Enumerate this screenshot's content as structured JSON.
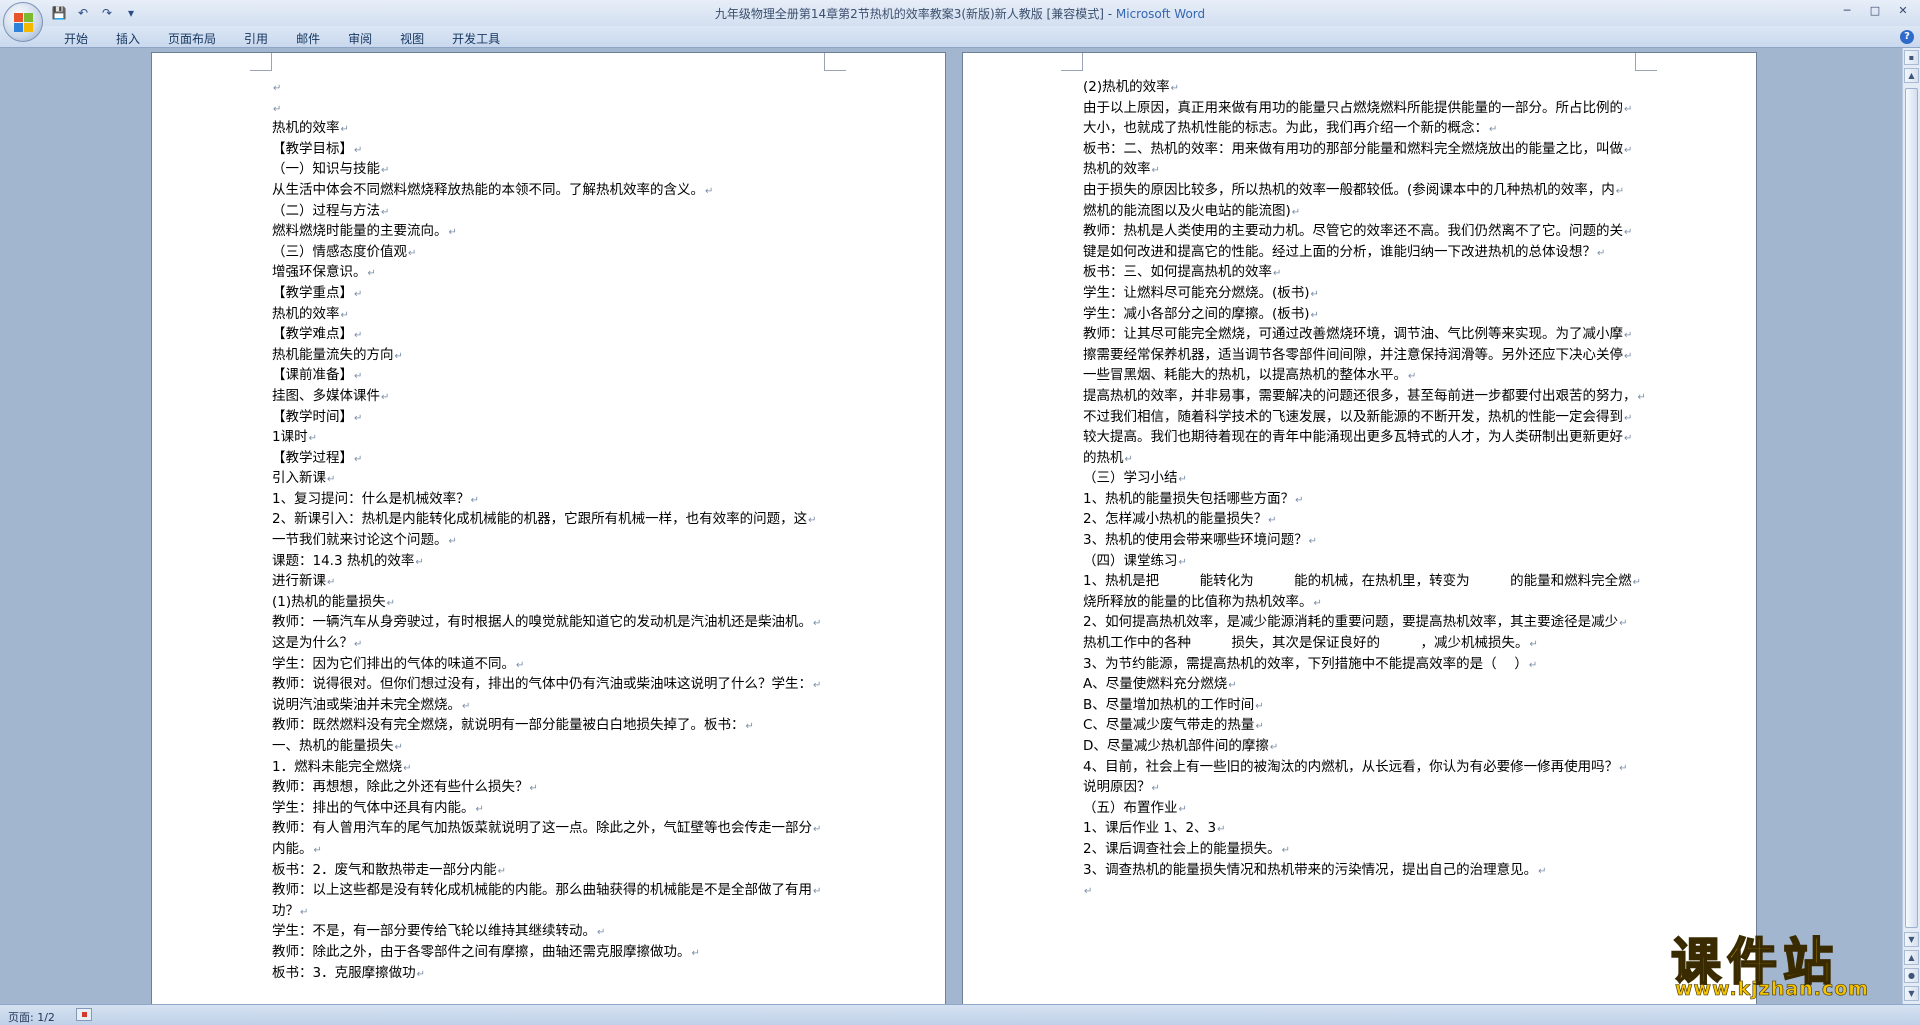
{
  "window": {
    "title": "九年级物理全册第14章第2节热机的效率教案3(新版)新人教版 [兼容模式] - ",
    "app_name": "Microsoft Word",
    "controls": {
      "minimize": "─",
      "maximize": "□",
      "close": "✕"
    }
  },
  "quick_access": {
    "save": "💾",
    "undo": "↶",
    "redo": "↷",
    "customize": "▾"
  },
  "ribbon": {
    "tabs": [
      "开始",
      "插入",
      "页面布局",
      "引用",
      "邮件",
      "审阅",
      "视图",
      "开发工具"
    ],
    "help": "?"
  },
  "pilcrow": "↵",
  "page1_lines": [
    "",
    "",
    "热机的效率",
    "【教学目标】",
    "（一）知识与技能",
    "从生活中体会不同燃料燃烧释放热能的本领不同。了解热机效率的含义。",
    "（二）过程与方法",
    "燃料燃烧时能量的主要流向。",
    "（三）情感态度价值观",
    "增强环保意识。",
    "【教学重点】",
    "热机的效率",
    "【教学难点】",
    "热机能量流失的方向",
    "【课前准备】",
    "挂图、多媒体课件",
    "【教学时间】",
    "1课时",
    "【教学过程】",
    "引入新课",
    "1、复习提问：什么是机械效率？",
    "2、新课引入：热机是内能转化成机械能的机器，它跟所有机械一样，也有效率的问题，这",
    "一节我们就来讨论这个问题。",
    "课题：14.3 热机的效率",
    "进行新课",
    " (1)热机的能量损失",
    "教师：一辆汽车从身旁驶过，有时根据人的嗅觉就能知道它的发动机是汽油机还是柴油机。",
    "这是为什么？",
    "学生：因为它们排出的气体的味道不同。",
    "教师：说得很对。但你们想过没有，排出的气体中仍有汽油或柴油味这说明了什么？学生：",
    "说明汽油或柴油并未完全燃烧。",
    "教师：既然燃料没有完全燃烧，就说明有一部分能量被白白地损失掉了。板书：",
    "一、热机的能量损失",
    "1．燃料未能完全燃烧",
    "教师：再想想，除此之外还有些什么损失？",
    "学生：排出的气体中还具有内能。",
    "教师：有人曾用汽车的尾气加热饭菜就说明了这一点。除此之外，气缸壁等也会传走一部分",
    "内能。",
    "板书：2．废气和散热带走一部分内能",
    "教师：以上这些都是没有转化成机械能的内能。那么曲轴获得的机械能是不是全部做了有用",
    "功？",
    "学生：不是，有一部分要传给飞轮以维持其继续转动。",
    "教师：除此之外，由于各零部件之间有摩擦，曲轴还需克服摩擦做功。",
    "板书：3．克服摩擦做功"
  ],
  "page2_lines": [
    " (2)热机的效率",
    "由于以上原因，真正用来做有用功的能量只占燃烧燃料所能提供能量的一部分。所占比例的",
    "大小，也就成了热机性能的标志。为此，我们再介绍一个新的概念：",
    "板书：二、热机的效率：用来做有用功的那部分能量和燃料完全燃烧放出的能量之比，叫做",
    "热机的效率",
    "由于损失的原因比较多，所以热机的效率一般都较低。(参阅课本中的几种热机的效率，内",
    "燃机的能流图以及火电站的能流图)",
    "教师：热机是人类使用的主要动力机。尽管它的效率还不高。我们仍然离不了它。问题的关",
    "键是如何改进和提高它的性能。经过上面的分析，谁能归纳一下改进热机的总体设想？",
    "板书：三、如何提高热机的效率",
    "学生：让燃料尽可能充分燃烧。(板书)",
    "学生：减小各部分之间的摩擦。(板书)",
    "教师：让其尽可能完全燃烧，可通过改善燃烧环境，调节油、气比例等来实现。为了减小摩",
    "擦需要经常保养机器，适当调节各零部件间间隙，并注意保持润滑等。另外还应下决心关停",
    "一些冒黑烟、耗能大的热机，以提高热机的整体水平。",
    "提高热机的效率，并非易事，需要解决的问题还很多，甚至每前进一步都要付出艰苦的努力，",
    "不过我们相信，随着科学技术的飞速发展，以及新能源的不断开发，热机的性能一定会得到",
    "较大提高。我们也期待着现在的青年中能涌现出更多瓦特式的人才，为人类研制出更新更好",
    "的热机",
    "（三）学习小结",
    "1、热机的能量损失包括哪些方面？",
    "2、怎样减小热机的能量损失？",
    "3、热机的使用会带来哪些环境问题？",
    "（四）课堂练习",
    "1、热机是把　　　能转化为　　　能的机械，在热机里，转变为　　　的能量和燃料完全燃",
    "烧所释放的能量的比值称为热机效率。",
    "2、如何提高热机效率，是减少能源消耗的重要问题，要提高热机效率，其主要途径是减少",
    "热机工作中的各种　　　损失，其次是保证良好的　　　，减少机械损失。",
    "3、为节约能源，需提高热机的效率，下列措施中不能提高效率的是（　 ）",
    "A、尽量使燃料充分燃烧",
    "B、尽量增加热机的工作时间",
    "C、尽量减少废气带走的热量",
    "D、尽量减少热机部件间的摩擦",
    "4、目前，社会上有一些旧的被淘汰的内燃机，从长远看，你认为有必要修一修再使用吗？",
    "说明原因？",
    "（五）布置作业",
    "1、课后作业 1、2、3",
    "2、课后调查社会上的能量损失。",
    "3、调查热机的能量损失情况和热机带来的污染情况，提出自己的治理意见。",
    ""
  ],
  "status": {
    "page": "页面: 1/2"
  },
  "watermark": {
    "main": "课件站",
    "url": "www.kjzhan.com"
  }
}
